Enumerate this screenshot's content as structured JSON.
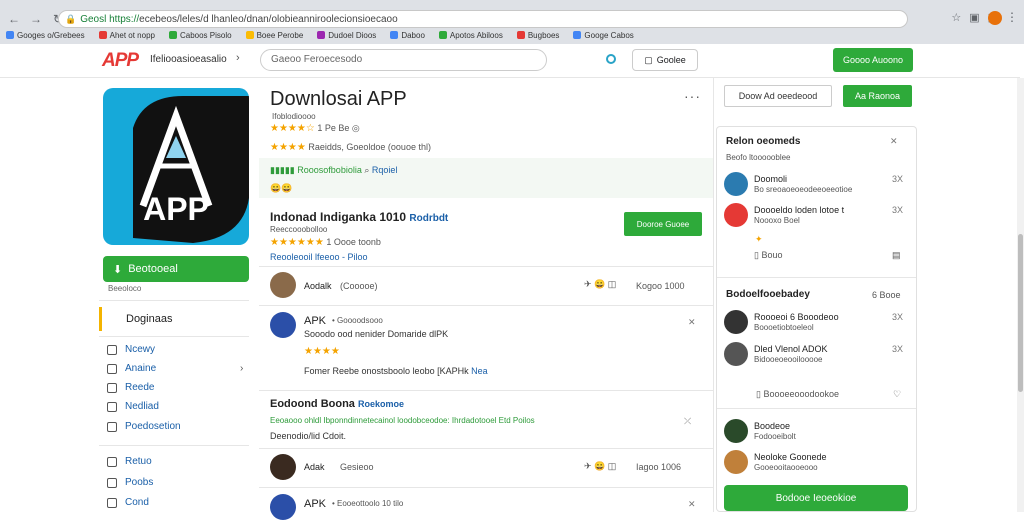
{
  "browser": {
    "url_secure": "Geosl https://",
    "url_rest": "ecebeos/leles/d lhanleo/dnan/olobieanniroolecionsioecaoo",
    "bookmarks": [
      "Googes o/Grebees",
      "Ahet ot nopp",
      "Caboos Pisolo",
      "Boee Perobe",
      "Dudoel Dioos",
      "Daboo",
      "Apotos Abiloos",
      "Bugboes",
      "Googe Cabos"
    ],
    "accent_green": "#2eaa3a"
  },
  "header": {
    "logo": "APP",
    "logo_sub": "Ifeliooasioeasalio",
    "search_placeholder": "Gaeoo Feroecesodo",
    "account_label": "Goolee",
    "cta_label": "Goooo Auoono"
  },
  "sidebar": {
    "download_label": "Beotooeal",
    "small_label": "Beeoloco",
    "active_label": "Doginaas",
    "items": [
      {
        "label": "Ncewy",
        "icon": "grid-icon"
      },
      {
        "label": "Anaine",
        "icon": "list-icon"
      },
      {
        "label": "Reede",
        "icon": "list-icon"
      },
      {
        "label": "Nedliad",
        "icon": "doc-icon"
      },
      {
        "label": "Poedosetion",
        "icon": "table-icon"
      },
      {
        "label": "Retuo",
        "icon": "calendar-icon"
      },
      {
        "label": "Poobs",
        "icon": "bookmark-icon"
      },
      {
        "label": "Cond",
        "icon": "doc-icon"
      }
    ]
  },
  "main": {
    "title": "Downlosai APP",
    "subtitle": "Ifoblodioooo",
    "rating_line": "1 Pe Be",
    "rating_stars": "★★★★☆",
    "desc_line": "Raeidds, Goeoldoe (oouoe thl)",
    "desc_stars": "★★★★",
    "banner_text": "Rooosofbobiolia",
    "banner_link": "Rqoiel",
    "review_heading": "Indonad Indiganka 1010",
    "review_heading_tag": "Rodrbdt",
    "review_sub": "Reeccooobolloo",
    "review_rating": "1 Oooe toonb",
    "review_links": "Reooleooil lfeeoo - Piloo",
    "review_btn": "Dooroe Guoee",
    "user1_name": "Aodalk",
    "user1_meta": "(Cooooe)",
    "user1_stats": "Kogoo 1000",
    "post1_title": "APK",
    "post1_meta": "• Goooodsooo",
    "post1_line": "Sooodo ood nenider Domaride dlPK",
    "post1_body": "Fomer Reebe onostsboolo leobo [KAPHk",
    "post1_tag": "Nea",
    "section_title": "Eodoond Boona",
    "section_tag": "Roekomoe",
    "section_line": "Eeoaooo ohldl Ibponndinnetecainol loodobceodoe: Ihrdadotooel Etd Poilos",
    "section_line2": "Deenodio/lid Cdoit.",
    "user2_name": "Adak",
    "user2_meta": "Gesieoo",
    "user2_stats": "Iagoo 1006",
    "post2_title": "APK",
    "post2_meta": "• Eooeottoolo 10 tilo"
  },
  "right": {
    "btn1": "Doow Ad oeedeood",
    "btn2": "Aa Raonoa",
    "panel1_title": "Relon oeomeds",
    "panel1_sub": "Beofo ltoooooblee",
    "items1": [
      {
        "name": "Doomoli",
        "desc": "Bo sreoaoeoeodeeoeeotioe",
        "x": "3X"
      },
      {
        "name": "Doooeldo loden lotoe t",
        "desc": "Noooxo Boel",
        "x": "3X"
      }
    ],
    "extra1": "Bouo",
    "panel2_title": "Bodoelfooebadey",
    "panel2_meta": "6 Booe",
    "items2": [
      {
        "name": "Roooeoi 6 Booodeoo",
        "desc": "Boooetiobtoeleol",
        "x": "3X"
      },
      {
        "name": "Dled Vlenol ADOK",
        "desc": "Bidooeoeooilooooe",
        "x": "3X"
      }
    ],
    "extra2": "Boooeeooodookoe",
    "items3": [
      {
        "name": "Boodeoe",
        "desc": "Fodooeibolt"
      },
      {
        "name": "Neoloke Goonede",
        "desc": "Gooeooitaooeooo"
      }
    ],
    "bottom_btn": "Bodooe Ieoeokioe"
  }
}
